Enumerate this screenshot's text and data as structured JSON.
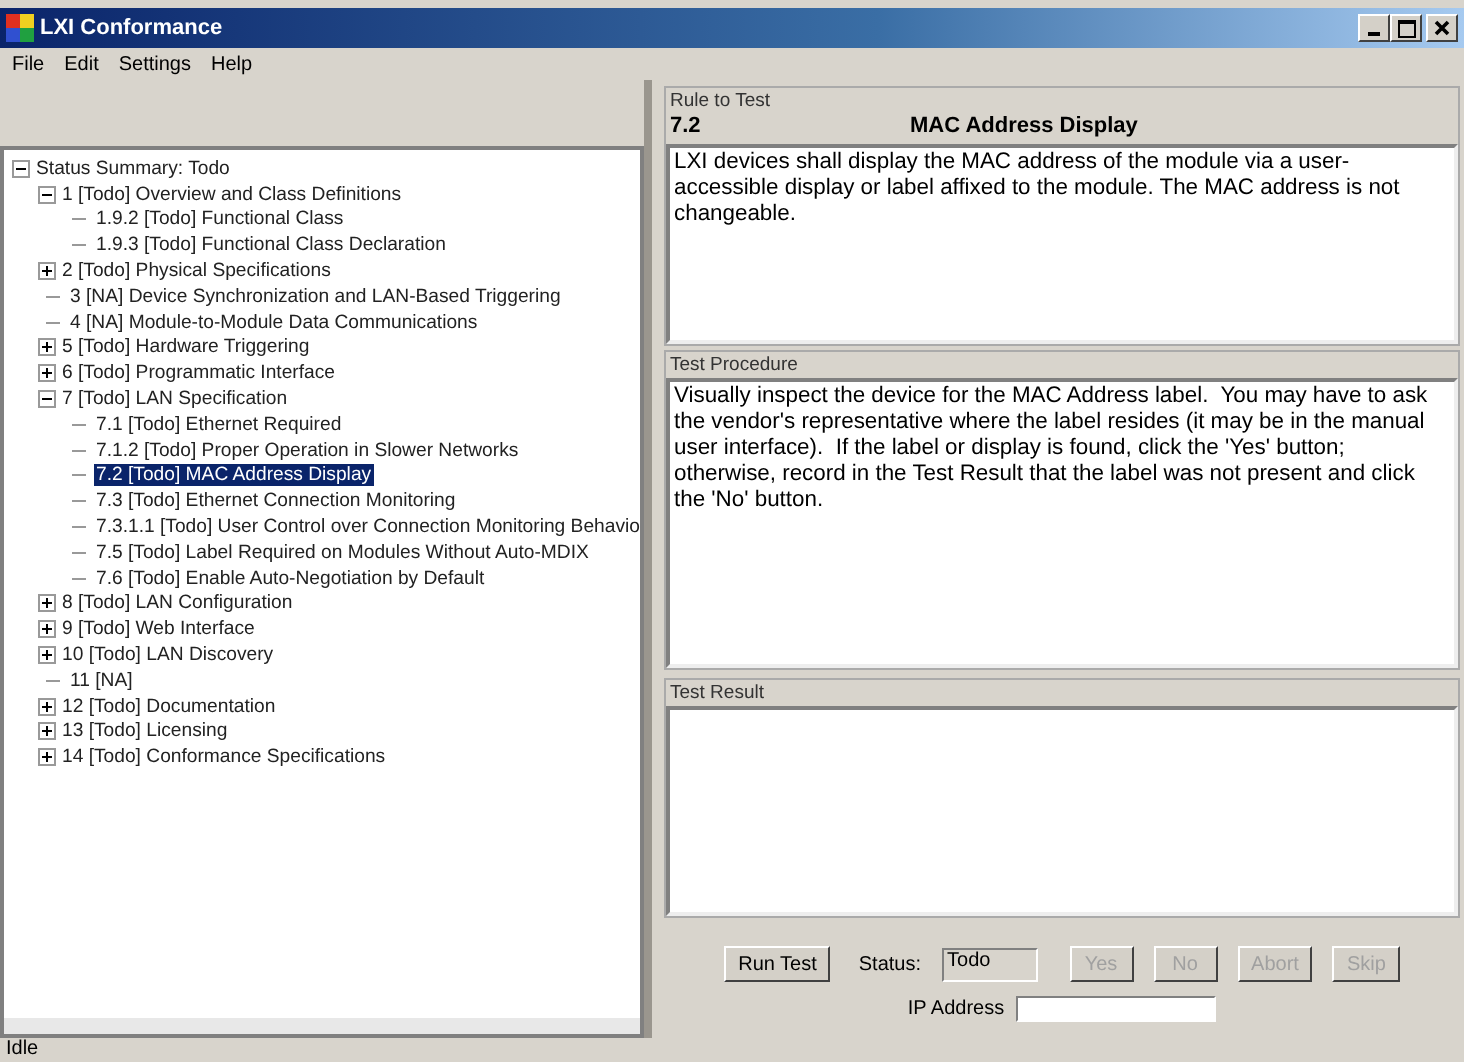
{
  "window": {
    "title": "LXI Conformance"
  },
  "menu": [
    "File",
    "Edit",
    "Settings",
    "Help"
  ],
  "tree": [
    {
      "label": "Status Summary: Todo",
      "kind": "folder",
      "expanded": true,
      "selected": false,
      "children": [
        {
          "label": "1 [Todo] Overview and Class Definitions",
          "kind": "folder",
          "expanded": true,
          "selected": false,
          "children": [
            {
              "label": "1.9.2 [Todo] Functional Class",
              "kind": "leaf",
              "selected": false
            },
            {
              "label": "1.9.3 [Todo] Functional Class Declaration",
              "kind": "leaf",
              "selected": false
            }
          ]
        },
        {
          "label": "2 [Todo] Physical Specifications",
          "kind": "folder",
          "expanded": false,
          "selected": false
        },
        {
          "label": "3 [NA] Device Synchronization and LAN-Based Triggering",
          "kind": "leaf",
          "selected": false
        },
        {
          "label": "4 [NA] Module-to-Module Data Communications",
          "kind": "leaf",
          "selected": false
        },
        {
          "label": "5 [Todo] Hardware Triggering",
          "kind": "folder",
          "expanded": false,
          "selected": false
        },
        {
          "label": "6 [Todo] Programmatic Interface",
          "kind": "folder",
          "expanded": false,
          "selected": false
        },
        {
          "label": "7 [Todo] LAN Specification",
          "kind": "folder",
          "expanded": true,
          "selected": false,
          "children": [
            {
              "label": "7.1 [Todo] Ethernet Required",
              "kind": "leaf",
              "selected": false
            },
            {
              "label": "7.1.2 [Todo] Proper Operation in Slower Networks",
              "kind": "leaf",
              "selected": false
            },
            {
              "label": "7.2 [Todo] MAC Address Display",
              "kind": "leaf",
              "selected": true
            },
            {
              "label": "7.3 [Todo] Ethernet Connection Monitoring",
              "kind": "leaf",
              "selected": false
            },
            {
              "label": "7.3.1.1 [Todo] User Control over Connection Monitoring Behavio",
              "kind": "leaf",
              "selected": false
            },
            {
              "label": "7.5 [Todo] Label Required on Modules Without Auto-MDIX",
              "kind": "leaf",
              "selected": false
            },
            {
              "label": "7.6 [Todo] Enable Auto-Negotiation by Default",
              "kind": "leaf",
              "selected": false
            }
          ]
        },
        {
          "label": "8 [Todo] LAN Configuration",
          "kind": "folder",
          "expanded": false,
          "selected": false
        },
        {
          "label": "9 [Todo] Web Interface",
          "kind": "folder",
          "expanded": false,
          "selected": false
        },
        {
          "label": "10 [Todo] LAN Discovery",
          "kind": "folder",
          "expanded": false,
          "selected": false
        },
        {
          "label": "11 [NA]",
          "kind": "leaf",
          "selected": false
        },
        {
          "label": "12 [Todo] Documentation",
          "kind": "folder",
          "expanded": false,
          "selected": false
        },
        {
          "label": "13 [Todo] Licensing",
          "kind": "folder",
          "expanded": false,
          "selected": false
        },
        {
          "label": "14 [Todo] Conformance Specifications",
          "kind": "folder",
          "expanded": false,
          "selected": false
        }
      ]
    }
  ],
  "rule": {
    "group_label": "Rule to Test",
    "number": "7.2",
    "title": "MAC Address Display",
    "text": "LXI devices shall display the MAC address of the module via a user-accessible display or label affixed to the module. The MAC address is not changeable."
  },
  "procedure": {
    "group_label": "Test Procedure",
    "text": "Visually inspect the device for the MAC Address label.  You may have to ask the vendor's representative where the label resides (it may be in the manual user interface).  If the label or display is found, click the 'Yes' button; otherwise, record in the Test Result that the label was not present and click the 'No' button."
  },
  "result": {
    "group_label": "Test Result"
  },
  "controls": {
    "run_button": {
      "label": "Run Test",
      "disabled": false
    },
    "status_label": "Status:",
    "status_value": "Todo",
    "buttons": [
      {
        "label": "Yes",
        "disabled": true
      },
      {
        "label": "No",
        "disabled": true
      },
      {
        "label": "Abort",
        "disabled": true
      },
      {
        "label": "Skip",
        "disabled": true
      }
    ],
    "ip_label": "IP Address"
  },
  "status_bar": "Idle"
}
